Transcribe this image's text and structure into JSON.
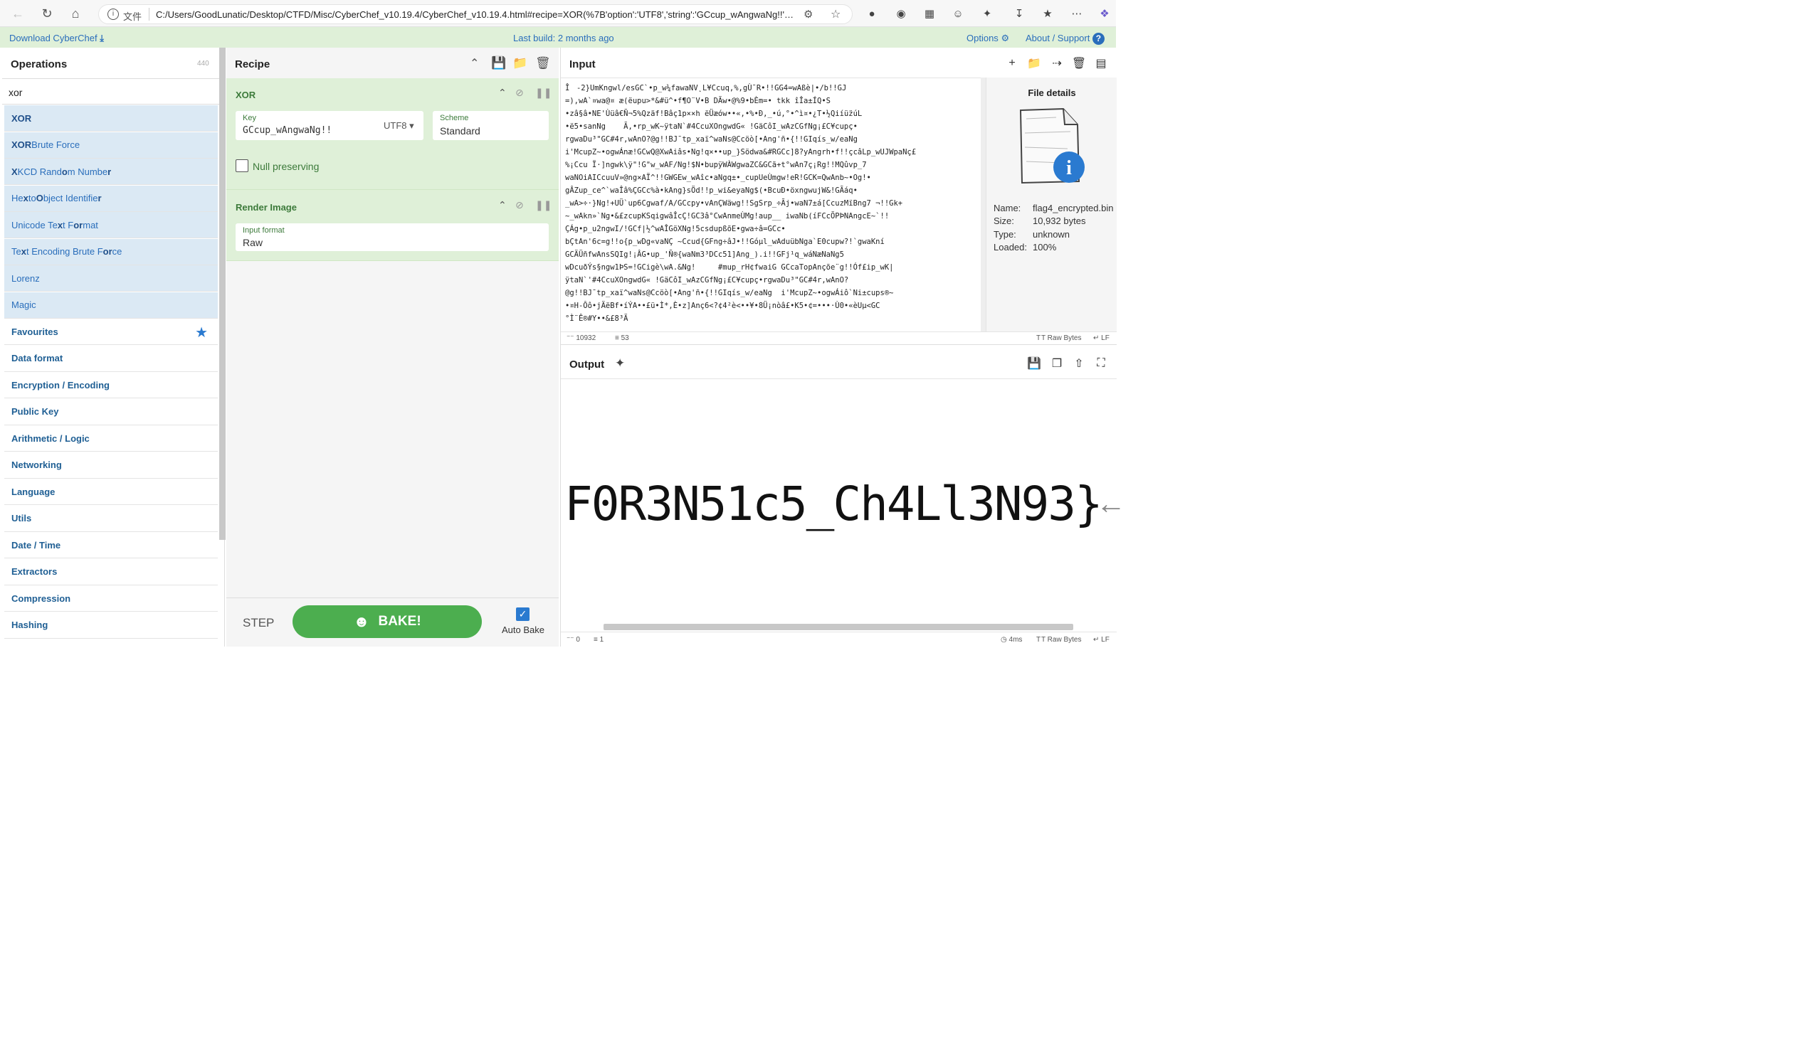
{
  "browser": {
    "scheme_label": "文件",
    "url": "C:/Users/GoodLunatic/Desktop/CTFD/Misc/CyberChef_v10.19.4/CyberChef_v10.19.4.html#recipe=XOR(%7B'option':'UTF8','string':'GCcup_wAngwaNg!!'%7D,..."
  },
  "banner": {
    "download": "Download CyberChef",
    "build": "Last build: 2 months ago",
    "options": "Options",
    "about": "About / Support"
  },
  "operations": {
    "title": "Operations",
    "count": "440",
    "search_value": "xor",
    "results": [
      {
        "pre": "",
        "hl": "XOR",
        "post": ""
      },
      {
        "pre": "",
        "hl": "XOR",
        "post": " Brute Force"
      },
      {
        "pre": "",
        "hl": "X",
        "post": "KCD Rand",
        "hl2": "o",
        "post2": "m Numbe",
        "hl3": "r",
        "post3": ""
      },
      {
        "pre": "He",
        "hl": "x",
        "post": " to ",
        "hl2": "O",
        "post2": "bject Identifie",
        "hl3": "r",
        "post3": ""
      },
      {
        "pre": "Unicode Te",
        "hl": "x",
        "post": "t F",
        "hl2": "o",
        "post2": "",
        "hl3": "r",
        "post3": "mat"
      },
      {
        "pre": "Te",
        "hl": "x",
        "post": "t Encoding Brute F",
        "hl2": "o",
        "post2": "",
        "hl3": "r",
        "post3": "ce"
      },
      {
        "pre": "Lorenz",
        "hl": "",
        "post": ""
      },
      {
        "pre": "Magic",
        "hl": "",
        "post": ""
      }
    ],
    "categories": [
      "Favourites",
      "Data format",
      "Encryption / Encoding",
      "Public Key",
      "Arithmetic / Logic",
      "Networking",
      "Language",
      "Utils",
      "Date / Time",
      "Extractors",
      "Compression",
      "Hashing"
    ]
  },
  "recipe": {
    "title": "Recipe",
    "xor": {
      "name": "XOR",
      "key_label": "Key",
      "key_value": "GCcup_wAngwaNg!!",
      "key_encoding": "UTF8",
      "scheme_label": "Scheme",
      "scheme_value": "Standard",
      "null_preserving": "Null preserving"
    },
    "render": {
      "name": "Render Image",
      "format_label": "Input format",
      "format_value": "Raw"
    },
    "step": "STEP",
    "bake": "BAKE!",
    "autobake": "Auto Bake"
  },
  "input": {
    "title": "Input",
    "text": "Îㅤ-2}UmKngwl/esGC`•p_w¼fawaNV˛L¥Ccuq,%,gÙ¯R•!!GG4=wAßè|•/b!!GJ\n=),wA`¤wa@¤ æ(ëupu>*&#ü^•f¶O¨V•B DÃw•@%9•bÈm=• tkk îÎa±ÍQ•S\n•zâ§â•NE'Ùüâ€Ñ¬5%Qzäf!Bâç1p××h ëÜæów••«,•%•Ð,_•ú,°•^ì¤•¿T•½Qiíü̈zúL\n•ë5•sanNg    Ã,•rp_wK~ÿtaN`#4CcuXOngwdG« !GäCôI_wAzCGfNg¡£C¥cupç•\nrgwaDu³\"GC#4r,wAnO?@g!!BJ¯tp_xaï^waNs@Ccöò[•Ang'ñ•{!!GIqís_w/eaNg\ni'McupZ~•ogwÁnæ!GCwQ@XwAiâs•Ng!q×••up_}Södwa&#RGCc]8?yAngrh•f!!çcâLp_wUJWpaNç£\n%¡Ccu Ï·]ngwk\\ÿ\"!G\"w_wAF/Ng!$N•bupÿWÀWgwaZC&GCã+t°wAn7ç¡Rg!!MQûvp_7\nwaNOiAICcuuV»@ng×AÏ^!!GWGEw_wAîc•aNgq±•_cupUeÙmgw!eR!GCK=QwAnb~•Og!•\ngÂZup_ce^`waÎâ%ÇGCc%à•kAng}sÖd!!p_wi&eyaNg$(•BcuÐ•öxngwujW&!GÃáq•\n_wA>÷·}Ng!+UÜ`up6Cgwaf/A/GCcpy•vAnÇWäwg!!SgSrp_÷Ãj•waN7±á[CcuzMïBng7 ¬!!Gk+\n~_wAkn»`Ng•&£zcupKSqigwâÎcÇ!GC3â°CwAnmeÙMg!aup__ iwaNb(íFCcÕPÞNAngcE~`!!\nÇÁg•p_u2ngwI/!GCf|½^wAÎGöXNg!5csdupßõE•gwa÷â=GCc•\nbÇtAn'6c=g!!o{p_wDg«vaNÇ ~Ccud{GFng÷âJ•!!Góµl_wAduübNga`E0cupw?!`gwaKní\nGCÄÜñfwAnsSQIg!¡ÂG•up_'Ñ®{waNm3³DCc51]Ang_).i!!GFj¹q_wáNæNaNg5\nwDcuðÝs§ngw1ÞS=!GCigè\\wA.&Ng!     #mup_rH¢fwaiG GCcaTopAnçõe¨g!!Óf£ip_wK|\nÿtaN`'#4CcuXOngwdG« !GäCôI_wAzCGfNg¡£C¥cupç•rgwaDu³\"GC#4r,wAnO?\n@g!!BJ¯tp_xaï^waNs@Ccöò[•Ang'ñ•{!!GIqís_w/eaNg  i'McupZ~•ogwÁiô`Ni±cups®~\n•¤H-Ôô•jÄëBf•íÝA••£ü•Ì*,È•z]Anç6<?¢4²è<••¥•8Ü¡nòâ£•K5•¢=•••·Ù0•«èUµ<GC\n°Ì¨Ê®#Y••&£8³Ä",
    "len": "10932",
    "lines": "53",
    "raw": "Raw Bytes",
    "lf": "LF"
  },
  "file": {
    "title": "File details",
    "name_label": "Name:",
    "name": "flag4_encrypted.bin",
    "size_label": "Size:",
    "size": "10,932 bytes",
    "type_label": "Type:",
    "type": "unknown",
    "loaded_label": "Loaded:",
    "loaded": "100%"
  },
  "output": {
    "title": "Output",
    "rendered": "F0R3N51c5_Ch4Ll3N93}",
    "len": "0",
    "lines": "1",
    "time": "4ms",
    "raw": "Raw Bytes",
    "lf": "LF"
  }
}
